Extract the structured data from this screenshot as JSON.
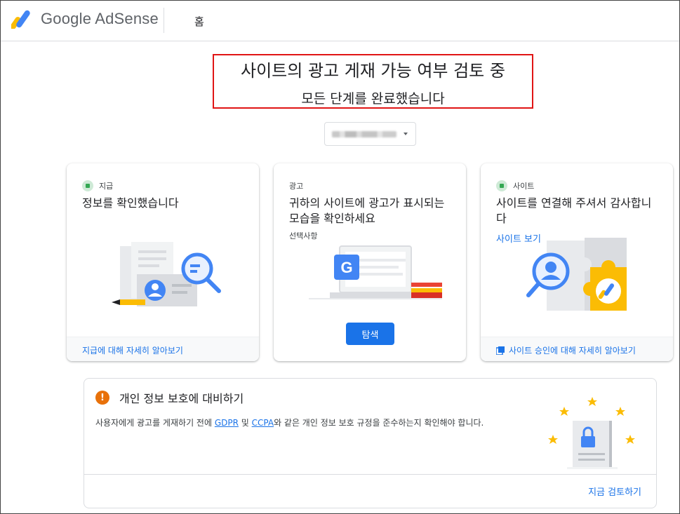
{
  "header": {
    "logo_text": "Google AdSense",
    "nav_home": "홈"
  },
  "hero": {
    "title": "사이트의 광고 게재 가능 여부 검토 중",
    "subtitle": "모든 단계를 완료했습니다"
  },
  "cards": [
    {
      "status": "지급",
      "title": "정보를 확인했습니다",
      "footer_link": "지급에 대해 자세히 알아보기"
    },
    {
      "tag": "광고",
      "title": "귀하의 사이트에 광고가 표시되는 모습을 확인하세요",
      "optional": "선택사항",
      "button": "탐색"
    },
    {
      "status": "사이트",
      "title": "사이트를 연결해 주셔서 감사합니다",
      "inline_link": "사이트 보기",
      "footer_link": "사이트 승인에 대해 자세히 알아보기"
    }
  ],
  "privacy": {
    "title": "개인 정보 보호에 대비하기",
    "desc_part1": "사용자에게 광고를 게재하기 전에 ",
    "gdpr": "GDPR",
    "desc_part2": " 및 ",
    "ccpa": "CCPA",
    "desc_part3": "와 같은 개인 정보 보호 규정을 준수하는지 확인해야 합니다.",
    "review_link": "지금 검토하기"
  },
  "colors": {
    "accent": "#1a73e8",
    "warning": "#e8710a",
    "success": "#34a853",
    "highlight_border": "#e01515"
  }
}
